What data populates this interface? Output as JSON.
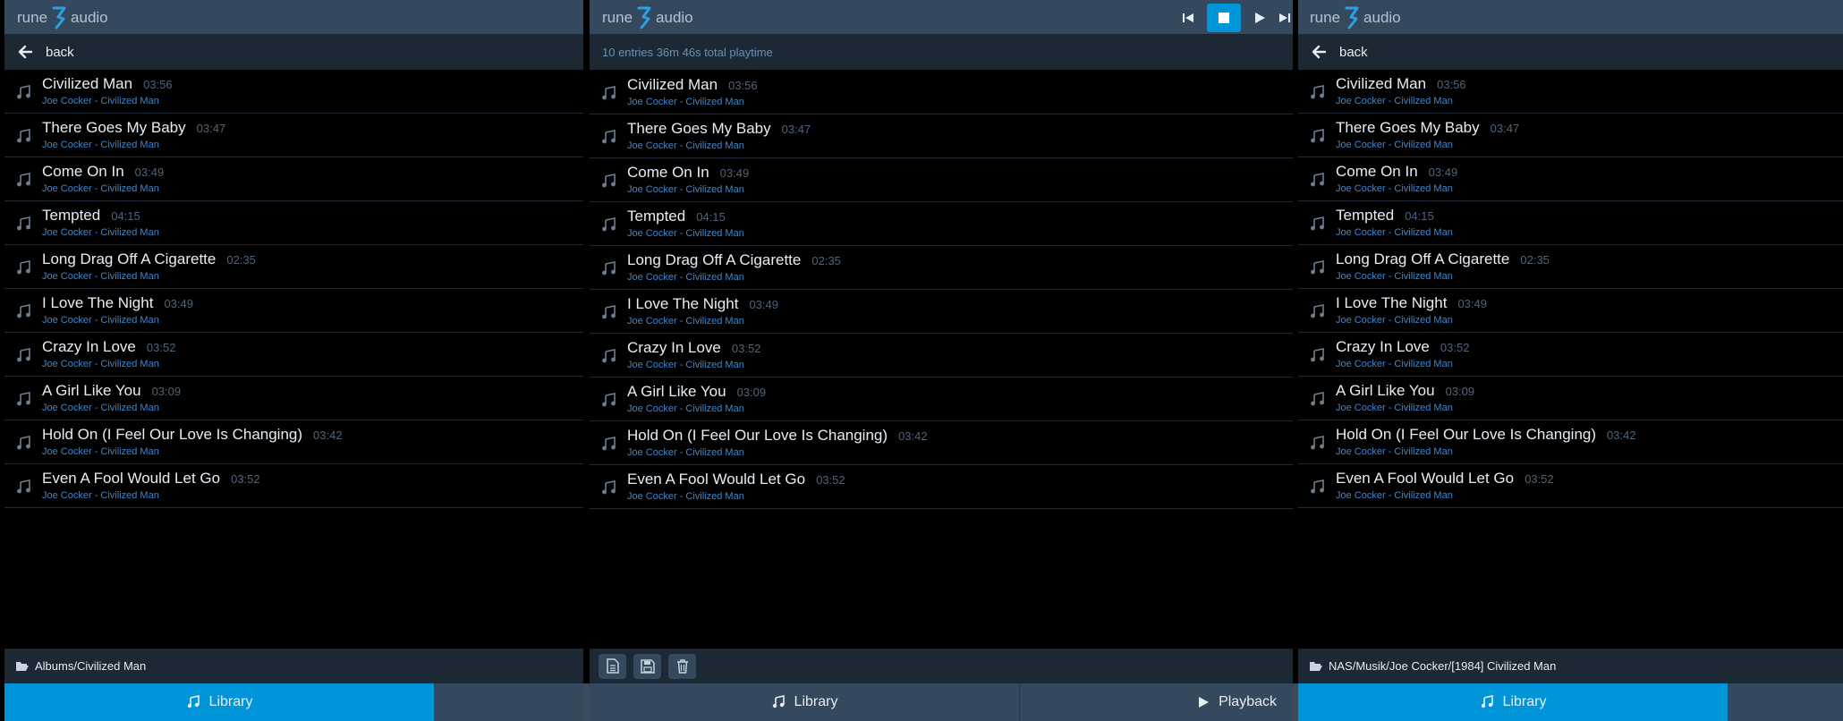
{
  "brand": {
    "word1": "rune",
    "word2": "audio"
  },
  "back_label": "back",
  "playlist_info": "10 entries 36m 46s total playtime",
  "tracks": [
    {
      "title": "Civilized Man",
      "duration": "03:56",
      "artist_album": "Joe Cocker - Civilized Man"
    },
    {
      "title": "There Goes My Baby",
      "duration": "03:47",
      "artist_album": "Joe Cocker - Civilized Man"
    },
    {
      "title": "Come On In",
      "duration": "03:49",
      "artist_album": "Joe Cocker - Civilized Man"
    },
    {
      "title": "Tempted",
      "duration": "04:15",
      "artist_album": "Joe Cocker - Civilized Man"
    },
    {
      "title": "Long Drag Off A Cigarette",
      "duration": "02:35",
      "artist_album": "Joe Cocker - Civilized Man"
    },
    {
      "title": "I Love The Night",
      "duration": "03:49",
      "artist_album": "Joe Cocker - Civilized Man"
    },
    {
      "title": "Crazy In Love",
      "duration": "03:52",
      "artist_album": "Joe Cocker - Civilized Man"
    },
    {
      "title": "A Girl Like You",
      "duration": "03:09",
      "artist_album": "Joe Cocker - Civilized Man"
    },
    {
      "title": "Hold On (I Feel Our Love Is Changing)",
      "duration": "03:42",
      "artist_album": "Joe Cocker - Civilized Man"
    },
    {
      "title": "Even A Fool Would Let Go",
      "duration": "03:52",
      "artist_album": "Joe Cocker - Civilized Man"
    }
  ],
  "panels": {
    "left": {
      "path": "Albums/Civilized Man"
    },
    "right": {
      "path": "NAS/Musik/Joe Cocker/[1984] Civilized Man"
    }
  },
  "nav": {
    "library": "Library",
    "playback": "Playback"
  },
  "icons": {
    "logo": "rune-logo-icon",
    "back": "arrow-left-icon",
    "track": "music-note-icon",
    "folder": "folder-open-icon",
    "prev": "skip-previous-icon",
    "stop": "stop-icon",
    "play": "play-icon",
    "next": "skip-next-icon",
    "new": "file-text-icon",
    "save": "save-icon",
    "delete": "trash-icon"
  },
  "colors": {
    "accent": "#0095d8",
    "header": "#34495e",
    "subbar": "#1c2833",
    "artist": "#3f86c8"
  }
}
